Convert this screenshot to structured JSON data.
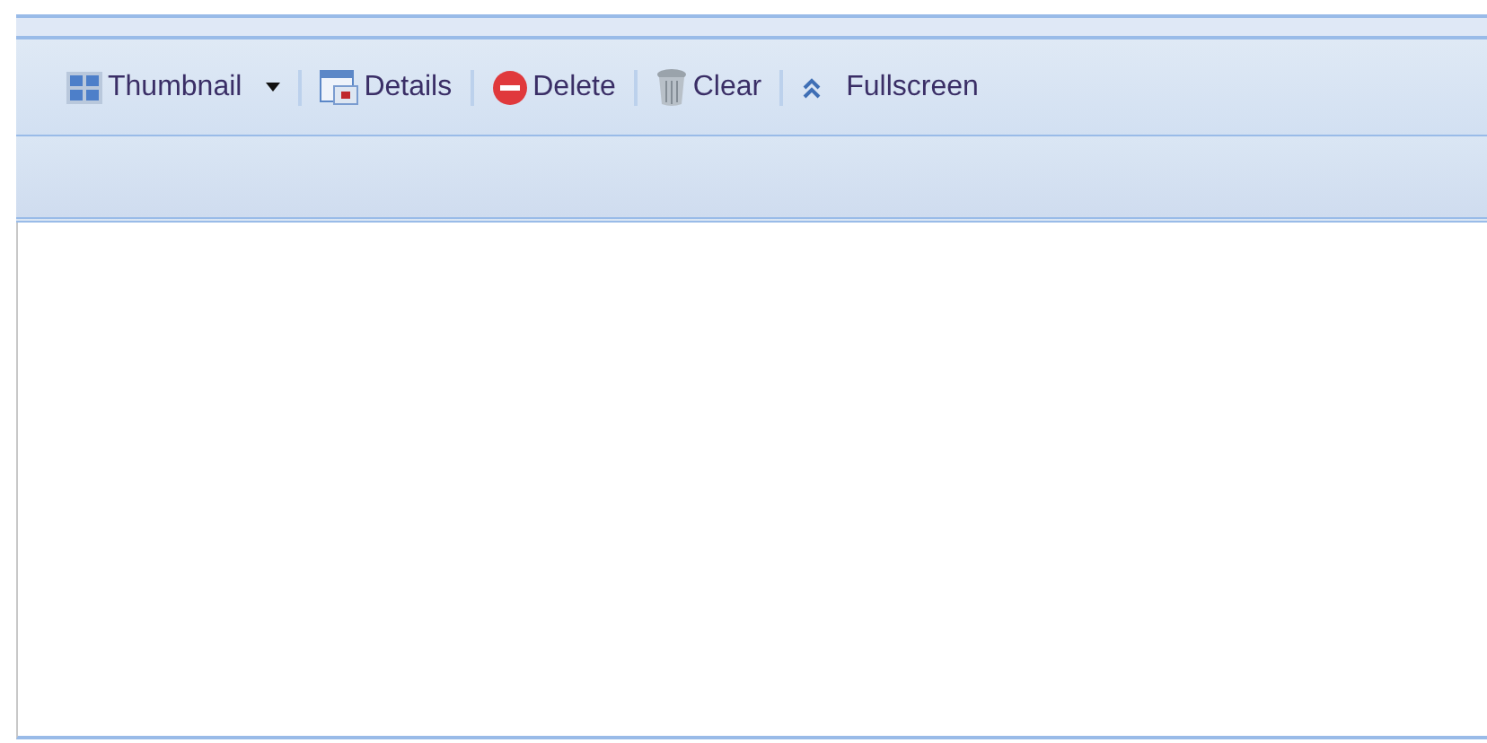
{
  "toolbar": {
    "buttons": [
      {
        "label": "Thumbnail",
        "has_menu": true
      },
      {
        "label": "Details",
        "has_menu": false
      },
      {
        "label": "Delete",
        "has_menu": false
      },
      {
        "label": "Clear",
        "has_menu": false
      },
      {
        "label": "Fullscreen",
        "has_menu": false
      }
    ]
  }
}
